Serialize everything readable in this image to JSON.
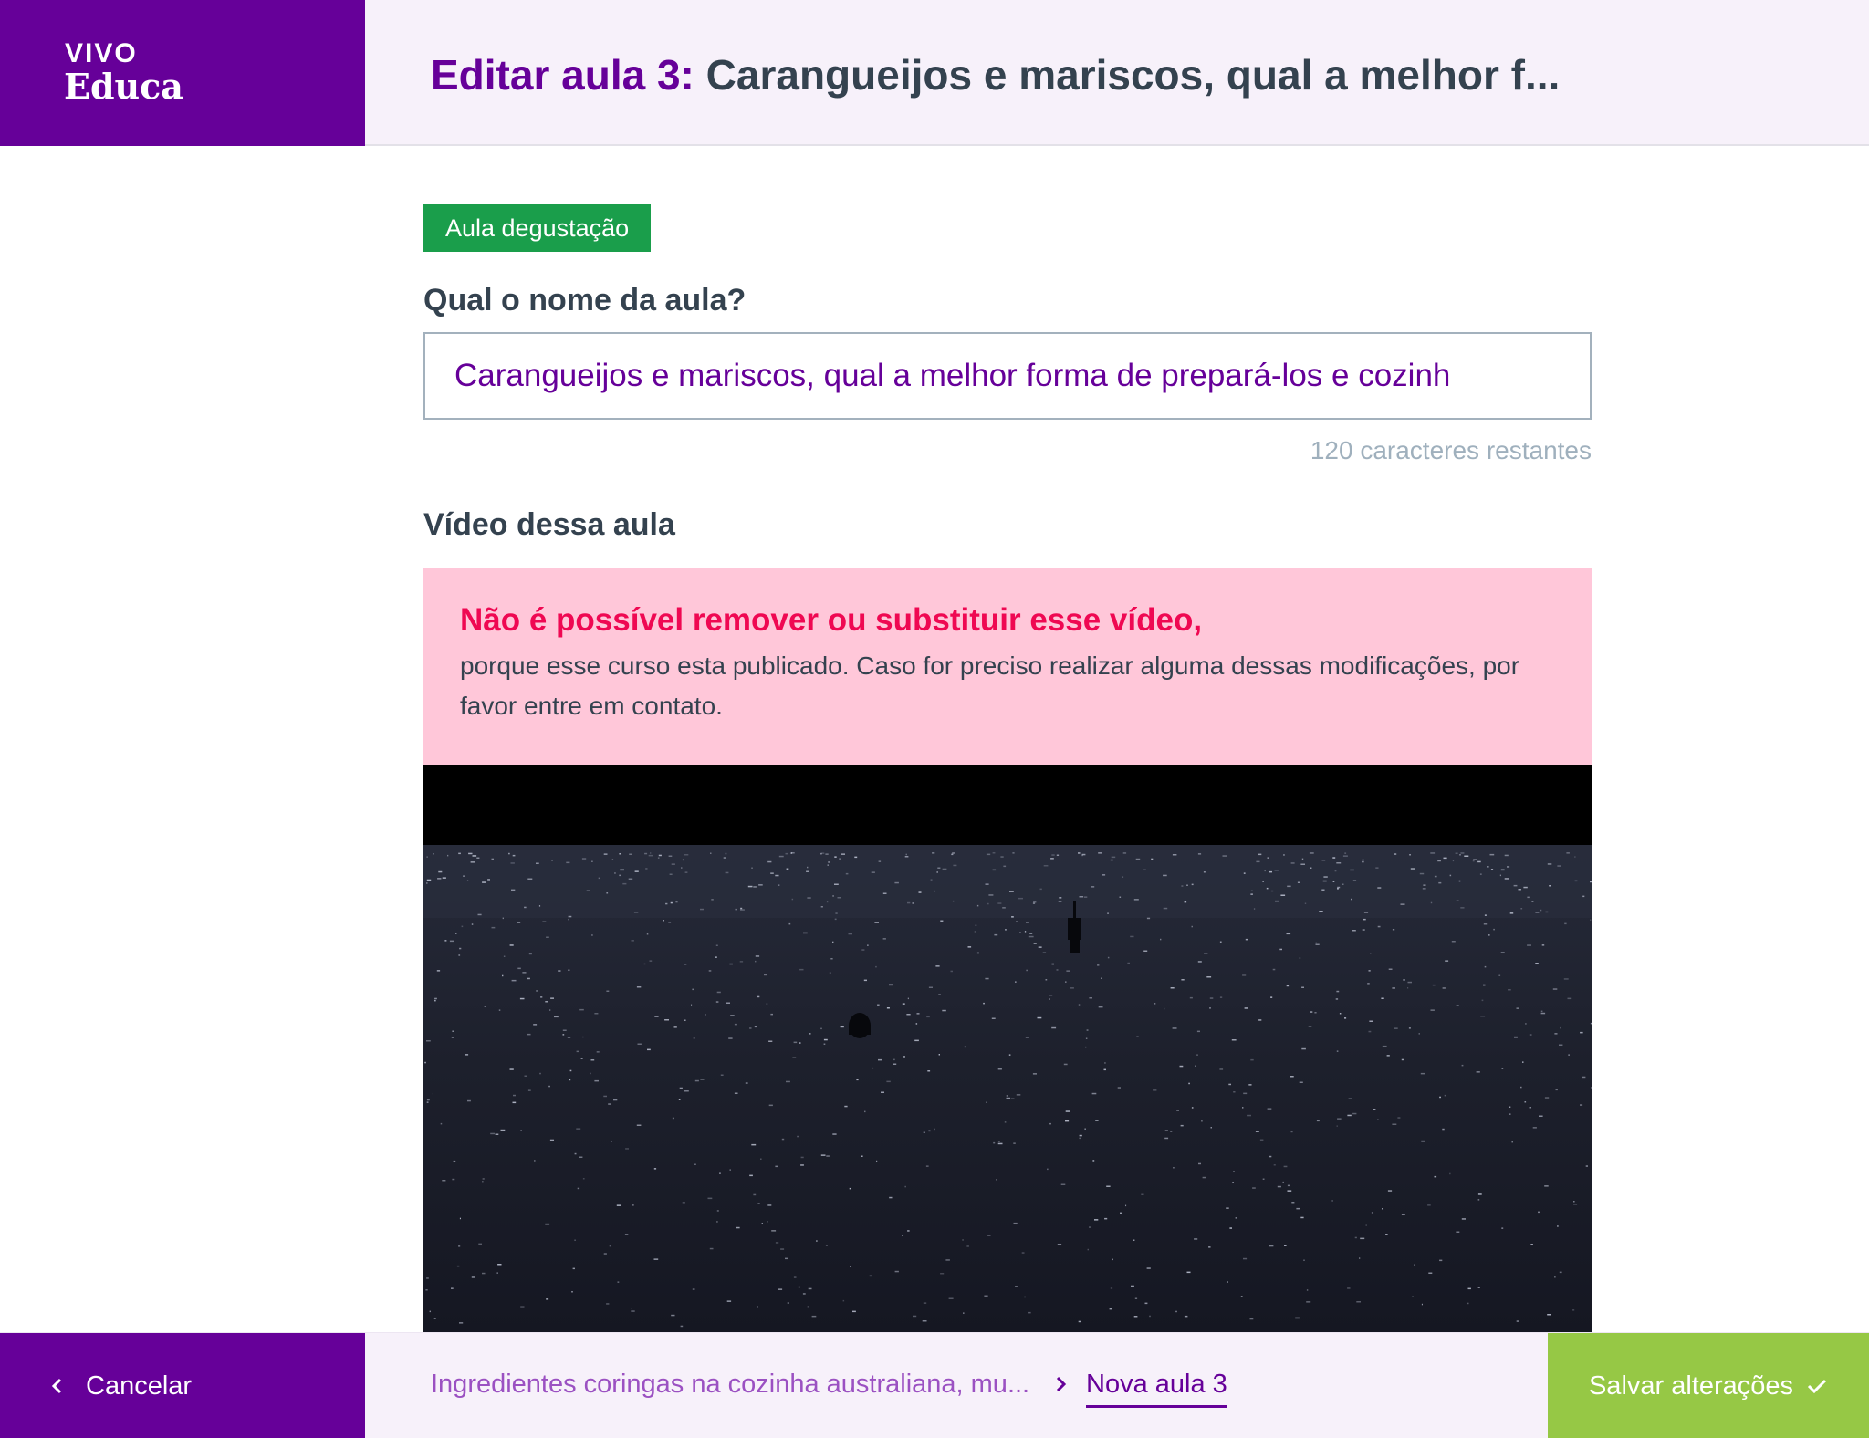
{
  "header": {
    "logo_top": "VIVO",
    "logo_bottom": "Educa",
    "title_prefix": "Editar aula 3: ",
    "title_name": "Carangueijos e mariscos, qual a melhor f..."
  },
  "main": {
    "badge": "Aula degustação",
    "name_label": "Qual o nome da aula?",
    "name_value": "Carangueijos e mariscos, qual a melhor forma de prepará-los e cozinh",
    "chars_remaining": "120 caracteres restantes",
    "video_label": "Vídeo dessa aula",
    "alert_title": "Não é possível remover ou substituir esse vídeo,",
    "alert_text": "porque esse curso esta publicado. Caso for preciso realizar alguma dessas modificações, por favor entre em contato."
  },
  "footer": {
    "cancel_label": "Cancelar",
    "breadcrumb_prev": "Ingredientes coringas na cozinha australiana, mu...",
    "breadcrumb_current": "Nova aula 3",
    "save_label": "Salvar alterações"
  },
  "icons": {
    "cancel": "chevron-left-icon",
    "breadcrumb_separator": "chevron-right-icon",
    "save": "check-icon"
  },
  "colors": {
    "brand_purple": "#660099",
    "header_bg": "#f7f1fa",
    "badge_green": "#1a9e4b",
    "save_green": "#96c845",
    "alert_bg": "#ffc7d9",
    "alert_title": "#ef0852",
    "text_dark": "#34424f",
    "muted": "#9fb0bd"
  }
}
